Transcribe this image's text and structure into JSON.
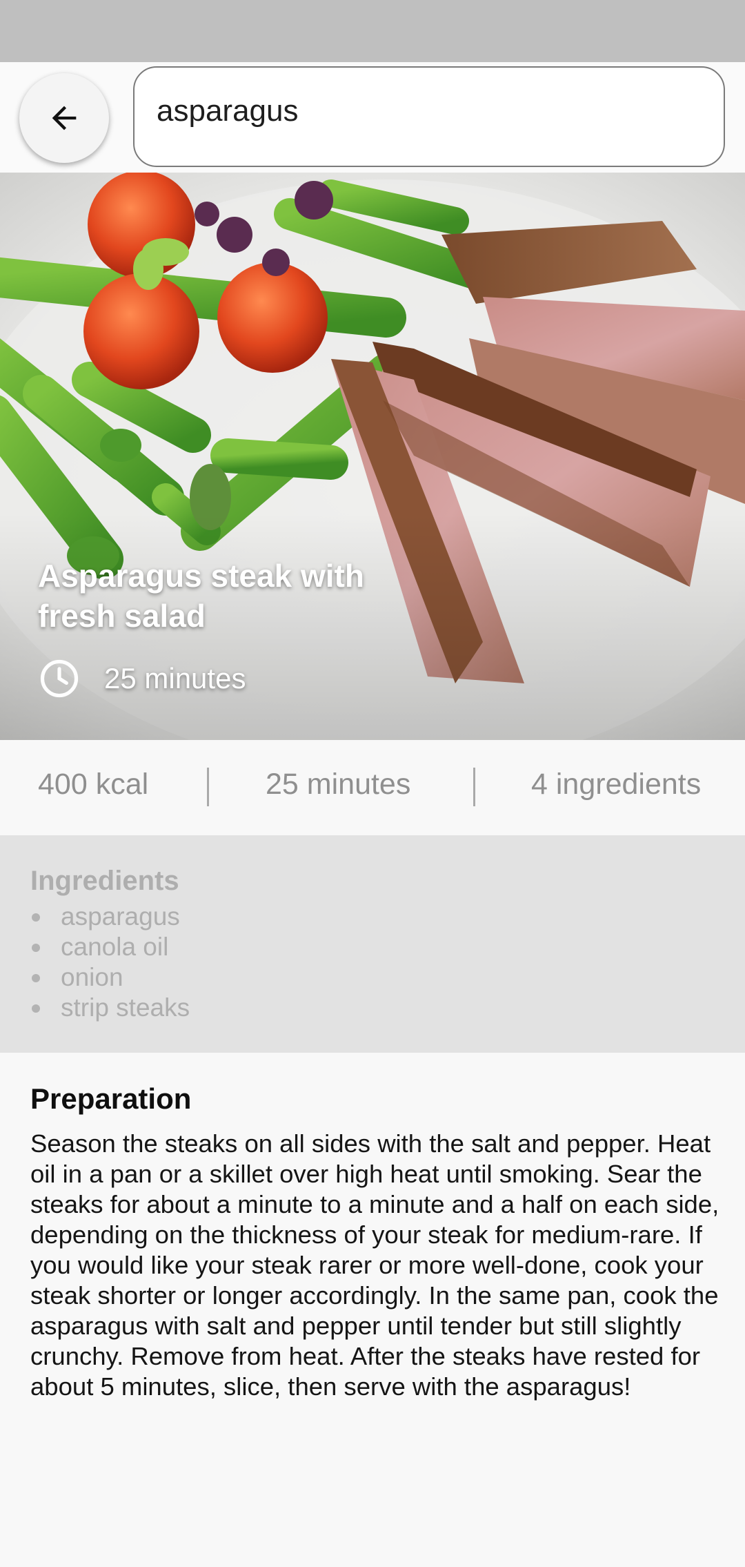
{
  "search": {
    "value": "asparagus"
  },
  "recipe": {
    "title": "Asparagus steak with fresh salad",
    "time": "25 minutes"
  },
  "stats": {
    "calories": "400 kcal",
    "duration": "25 minutes",
    "ingredient_count": "4 ingredients"
  },
  "ingredients": {
    "heading": "Ingredients",
    "items": [
      "asparagus",
      "canola oil",
      "onion",
      "strip steaks"
    ]
  },
  "preparation": {
    "heading": "Preparation",
    "text": "Season the steaks on all sides with the salt and pepper. Heat oil in a pan or a skillet over high heat until smoking. Sear the steaks for about a minute to a minute and a half on each side, depending on the thickness of your steak for medium-rare. If you would like your steak rarer or more well-done, cook your steak shorter or longer accordingly. In the same pan, cook the asparagus with salt and pepper until tender but still slightly crunchy. Remove from heat. After the steaks have rested for about 5 minutes, slice, then serve with the asparagus!"
  },
  "icons": {
    "back": "arrow-left-icon",
    "time": "clock-icon"
  }
}
